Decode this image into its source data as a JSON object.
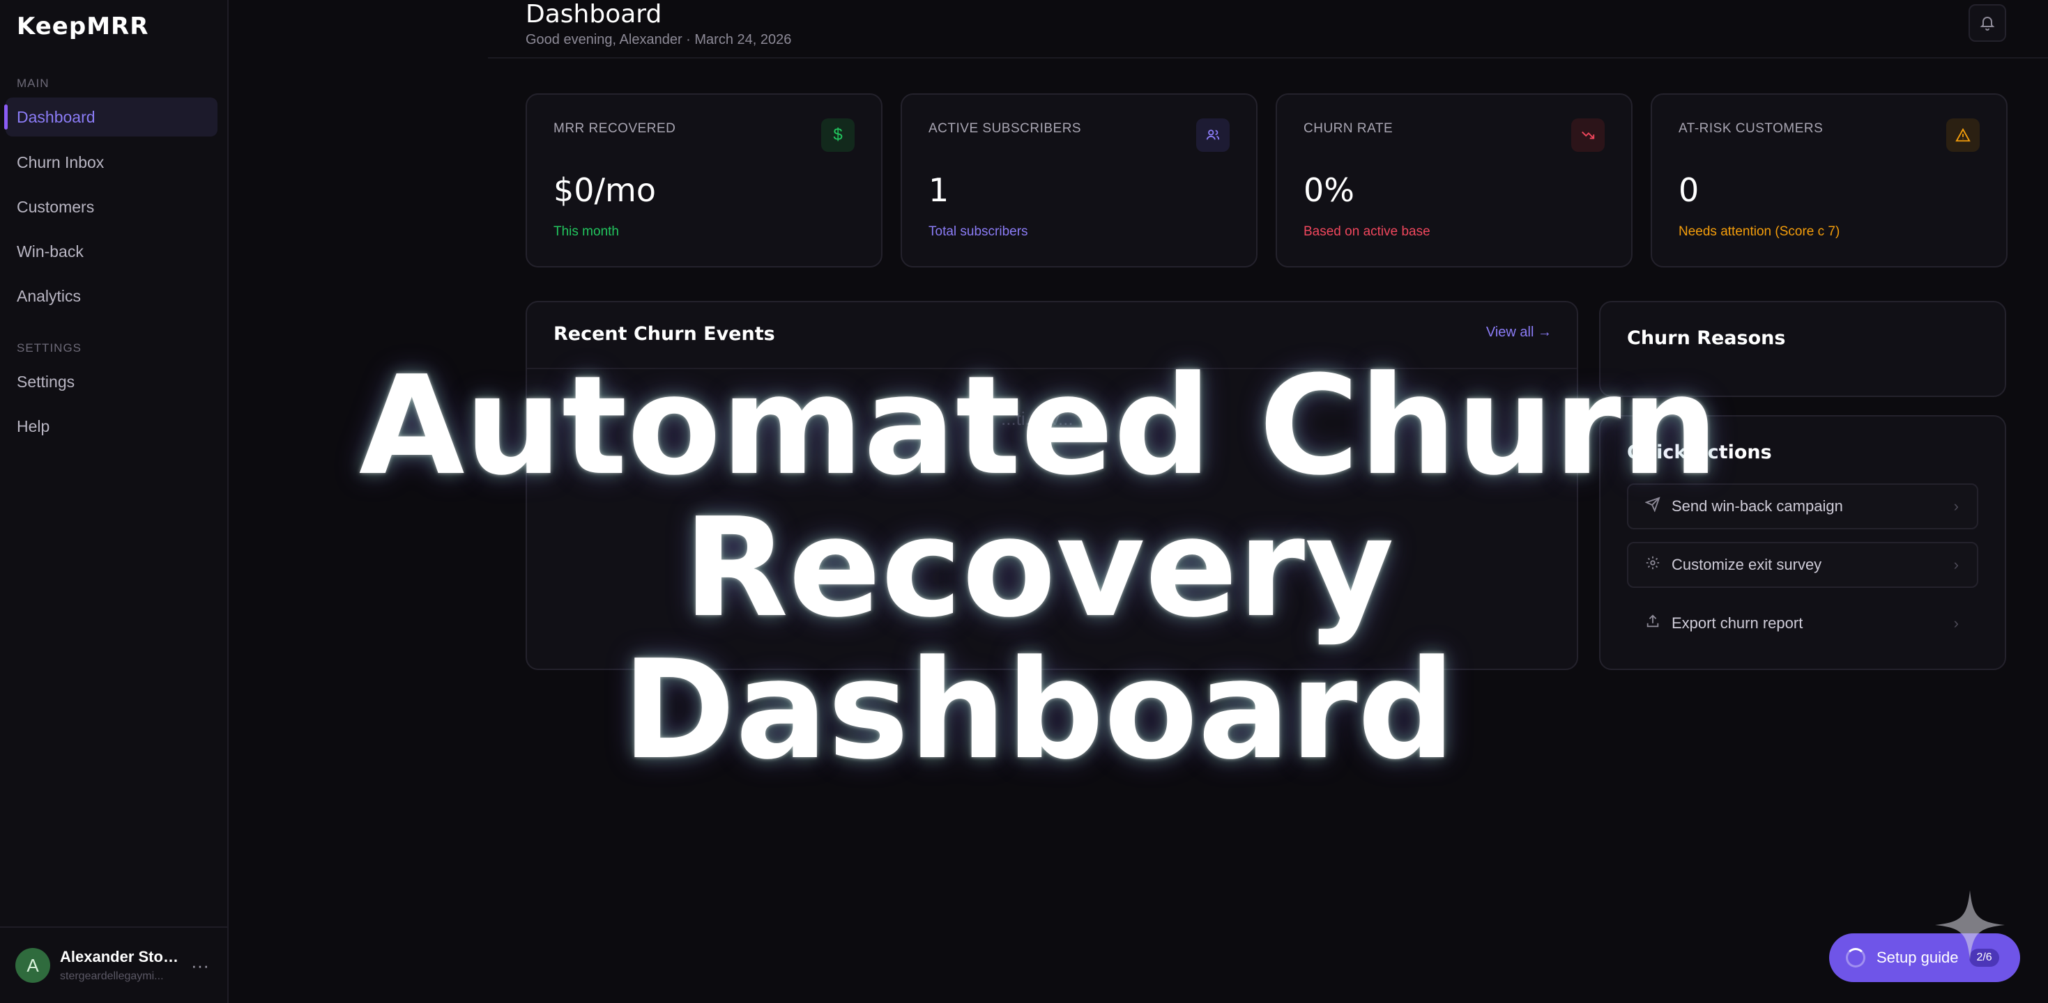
{
  "app": {
    "brand": "KeepMRR"
  },
  "sidebar": {
    "main_label": "MAIN",
    "items": [
      {
        "label": "Dashboard",
        "active": true
      },
      {
        "label": "Churn Inbox"
      },
      {
        "label": "Customers"
      },
      {
        "label": "Win-back"
      },
      {
        "label": "Analytics"
      }
    ],
    "settings_label": "SETTINGS",
    "settings_items": [
      {
        "label": "Settings"
      },
      {
        "label": "Help"
      }
    ],
    "user": {
      "initial": "A",
      "name": "Alexander Storg...",
      "email": "stergeardellegaymi...",
      "more": "···"
    }
  },
  "header": {
    "title": "Dashboard",
    "subtitle": "Good evening, Alexander · March 24, 2026",
    "bell_icon": "bell-icon"
  },
  "stats": [
    {
      "label": "MRR RECOVERED",
      "value": "$0/mo",
      "note": "This month",
      "icon": "dollar-icon",
      "accent": "#22c55e",
      "icon_bg": "#12291c"
    },
    {
      "label": "ACTIVE SUBSCRIBERS",
      "value": "1",
      "note": "Total subscribers",
      "icon": "users-icon",
      "accent": "#8b7cf6",
      "icon_bg": "#1d1b33"
    },
    {
      "label": "CHURN RATE",
      "value": "0%",
      "note": "Based on active base",
      "icon": "trending-down-icon",
      "accent": "#f0475d",
      "icon_bg": "#2c1419"
    },
    {
      "label": "AT-RISK CUSTOMERS",
      "value": "0",
      "note": "Needs attention (Score c 7)",
      "icon": "warning-icon",
      "accent": "#f59e0b",
      "icon_bg": "#2b2012"
    }
  ],
  "recent": {
    "title": "Recent Churn Events",
    "view_all": "View all →",
    "empty": "...ti...ev..."
  },
  "reasons": {
    "title": "Churn Reasons"
  },
  "quick_actions": {
    "title": "Quick Actions",
    "items": [
      {
        "label": "Send win-back campaign",
        "icon": "send-icon"
      },
      {
        "label": "Customize exit survey",
        "icon": "gear-icon"
      },
      {
        "label": "Export churn report",
        "icon": "export-icon"
      }
    ]
  },
  "overlay": {
    "line1": "Automated Churn",
    "line2": "Recovery Dashboard"
  },
  "setup_guide": {
    "label": "Setup guide",
    "badge": "2/6"
  }
}
